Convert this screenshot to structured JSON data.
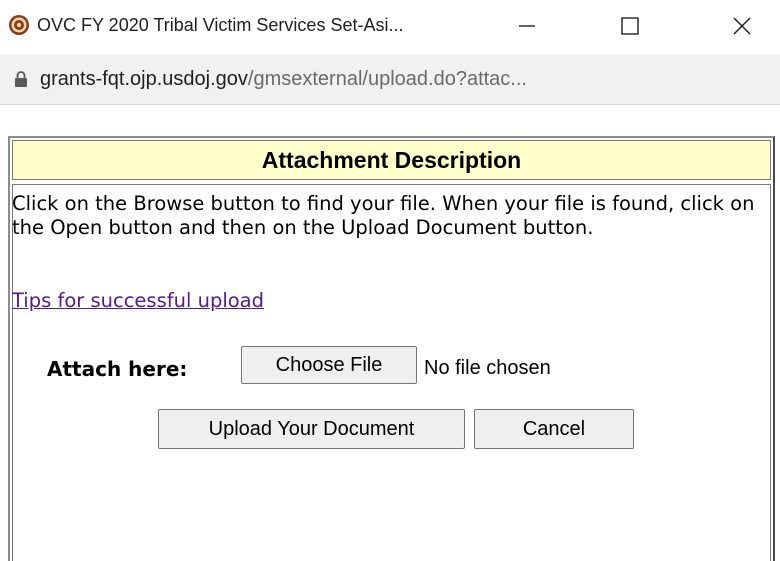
{
  "window": {
    "title": "OVC FY 2020 Tribal Victim Services Set-Asi...",
    "icon": "doj-seal-icon",
    "controls": {
      "minimize_icon": "minimize-icon",
      "maximize_icon": "maximize-icon",
      "close_icon": "close-icon"
    }
  },
  "address_bar": {
    "lock_icon": "lock-icon",
    "url_host": "grants-fqt.ojp.usdoj.gov",
    "url_path": "/gmsexternal/upload.do?attac..."
  },
  "page": {
    "header_title": "Attachment Description",
    "header_bg_color": "#ffffcc",
    "instructions": "Click on the Browse button to find your file. When your file is found, click on the Open button and then on the Upload Document button.",
    "tips_link": "Tips for successful upload",
    "link_color": "#551a8b",
    "attach_label": "Attach here:",
    "choose_file_label": "Choose File",
    "no_file_text": "No file chosen",
    "upload_button_label": "Upload Your Document",
    "cancel_button_label": "Cancel"
  }
}
